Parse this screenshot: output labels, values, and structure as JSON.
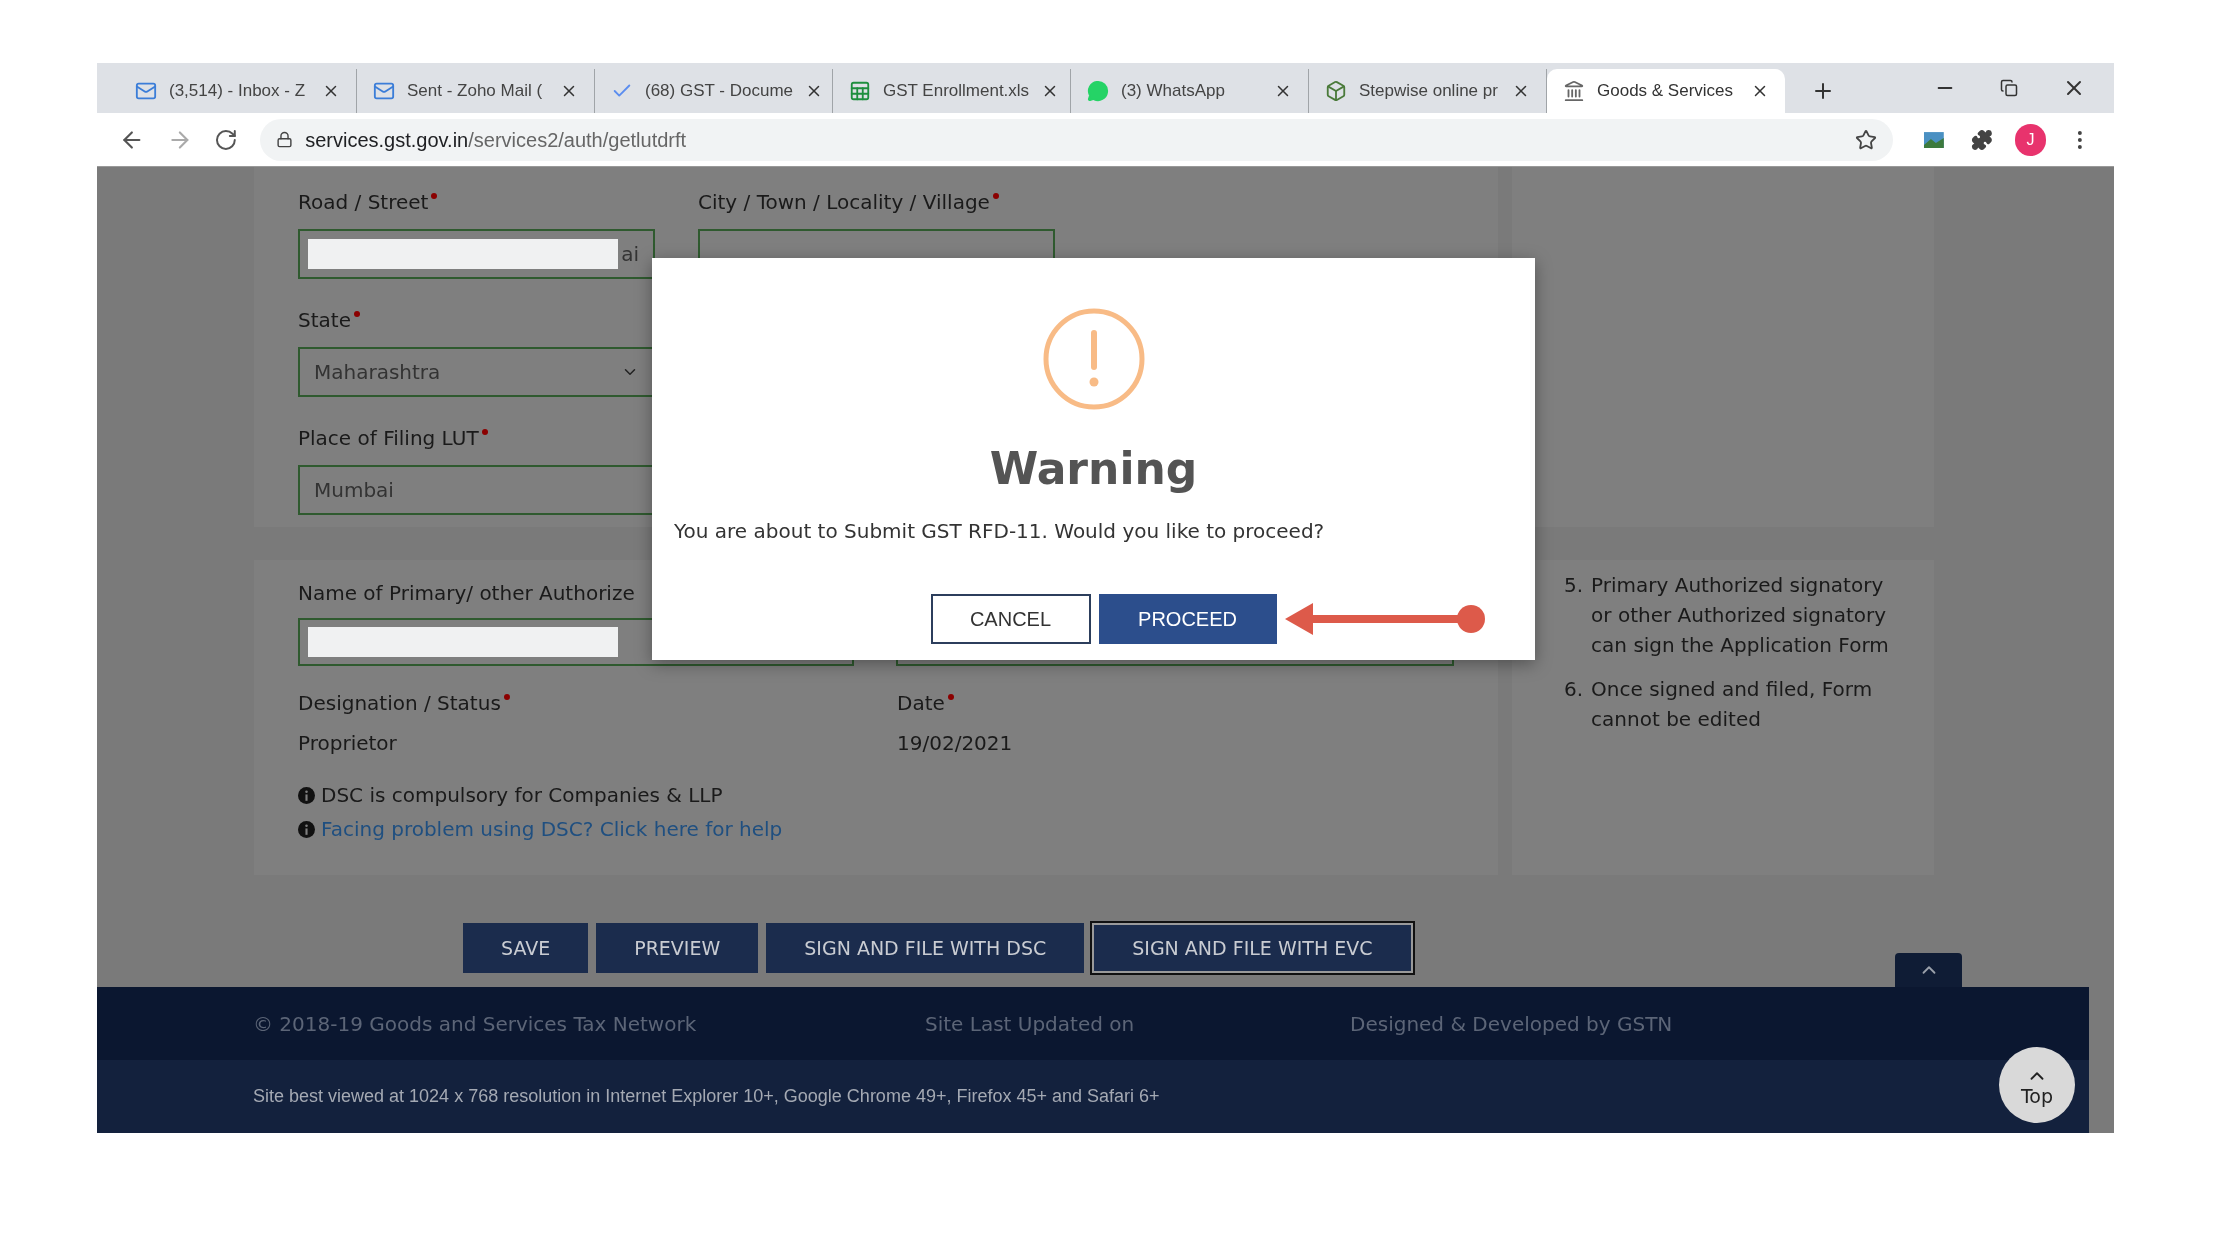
{
  "browser": {
    "tabs": [
      {
        "title": "(3,514) - Inbox - Z",
        "selected": false
      },
      {
        "title": "Sent - Zoho Mail (",
        "selected": false
      },
      {
        "title": "(68) GST - Docume",
        "selected": false
      },
      {
        "title": "GST Enrollment.xls",
        "selected": false
      },
      {
        "title": "(3) WhatsApp",
        "selected": false
      },
      {
        "title": "Stepwise online pr",
        "selected": false
      },
      {
        "title": "Goods & Services",
        "selected": true
      }
    ],
    "url_host": "services.gst.gov.in",
    "url_path": "/services2/auth/getlutdrft",
    "profile_initial": "J"
  },
  "address_card": {
    "column_1": [
      {
        "label": "Road / Street",
        "required": true,
        "kind": "text",
        "value": "ai",
        "redacted": true
      },
      {
        "label": "State",
        "required": true,
        "kind": "select",
        "value": "Maharashtra"
      },
      {
        "label": "Place of Filing LUT",
        "required": true,
        "kind": "text",
        "value": "Mumbai"
      }
    ],
    "column_2": [
      {
        "label": "City / Town / Locality / Village",
        "required": true
      }
    ]
  },
  "signatory_card": {
    "name_label": "Name of Primary/ other Authorize",
    "name_redacted": true,
    "designation": {
      "label": "Designation / Status",
      "required": true,
      "value": "Proprietor"
    },
    "date": {
      "label": "Date",
      "required": true,
      "value": "19/02/2021"
    },
    "notes": [
      {
        "kind": "info",
        "text": "DSC is compulsory for Companies & LLP"
      },
      {
        "kind": "link",
        "text": "Facing problem using DSC? Click here for help"
      }
    ]
  },
  "instructions": [
    {
      "number": "5.",
      "text": "Primary Authorized signatory or other Authorized signatory can sign the Application Form"
    },
    {
      "number": "6.",
      "text": "Once signed and filed, Form cannot be edited"
    }
  ],
  "actions": [
    {
      "label": "SAVE",
      "focused": false
    },
    {
      "label": "PREVIEW",
      "focused": false
    },
    {
      "label": "SIGN AND FILE WITH DSC",
      "focused": false
    },
    {
      "label": "SIGN AND FILE WITH EVC",
      "focused": true
    }
  ],
  "modal": {
    "title": "Warning",
    "message": "You are about to Submit GST RFD-11. Would you like to proceed?",
    "buttons": [
      {
        "label": "CANCEL",
        "kind": "secondary"
      },
      {
        "label": "PROCEED",
        "kind": "primary"
      }
    ]
  },
  "footer": {
    "copyright": "© 2018-19 Goods and Services Tax Network",
    "last_updated": "Site Last Updated on",
    "developer": "Designed & Developed by GSTN",
    "best_viewed": "Site best viewed at 1024 x 768 resolution in Internet Explorer 10+, Google Chrome 49+, Firefox 45+ and Safari 6+",
    "top_label": "Top"
  }
}
